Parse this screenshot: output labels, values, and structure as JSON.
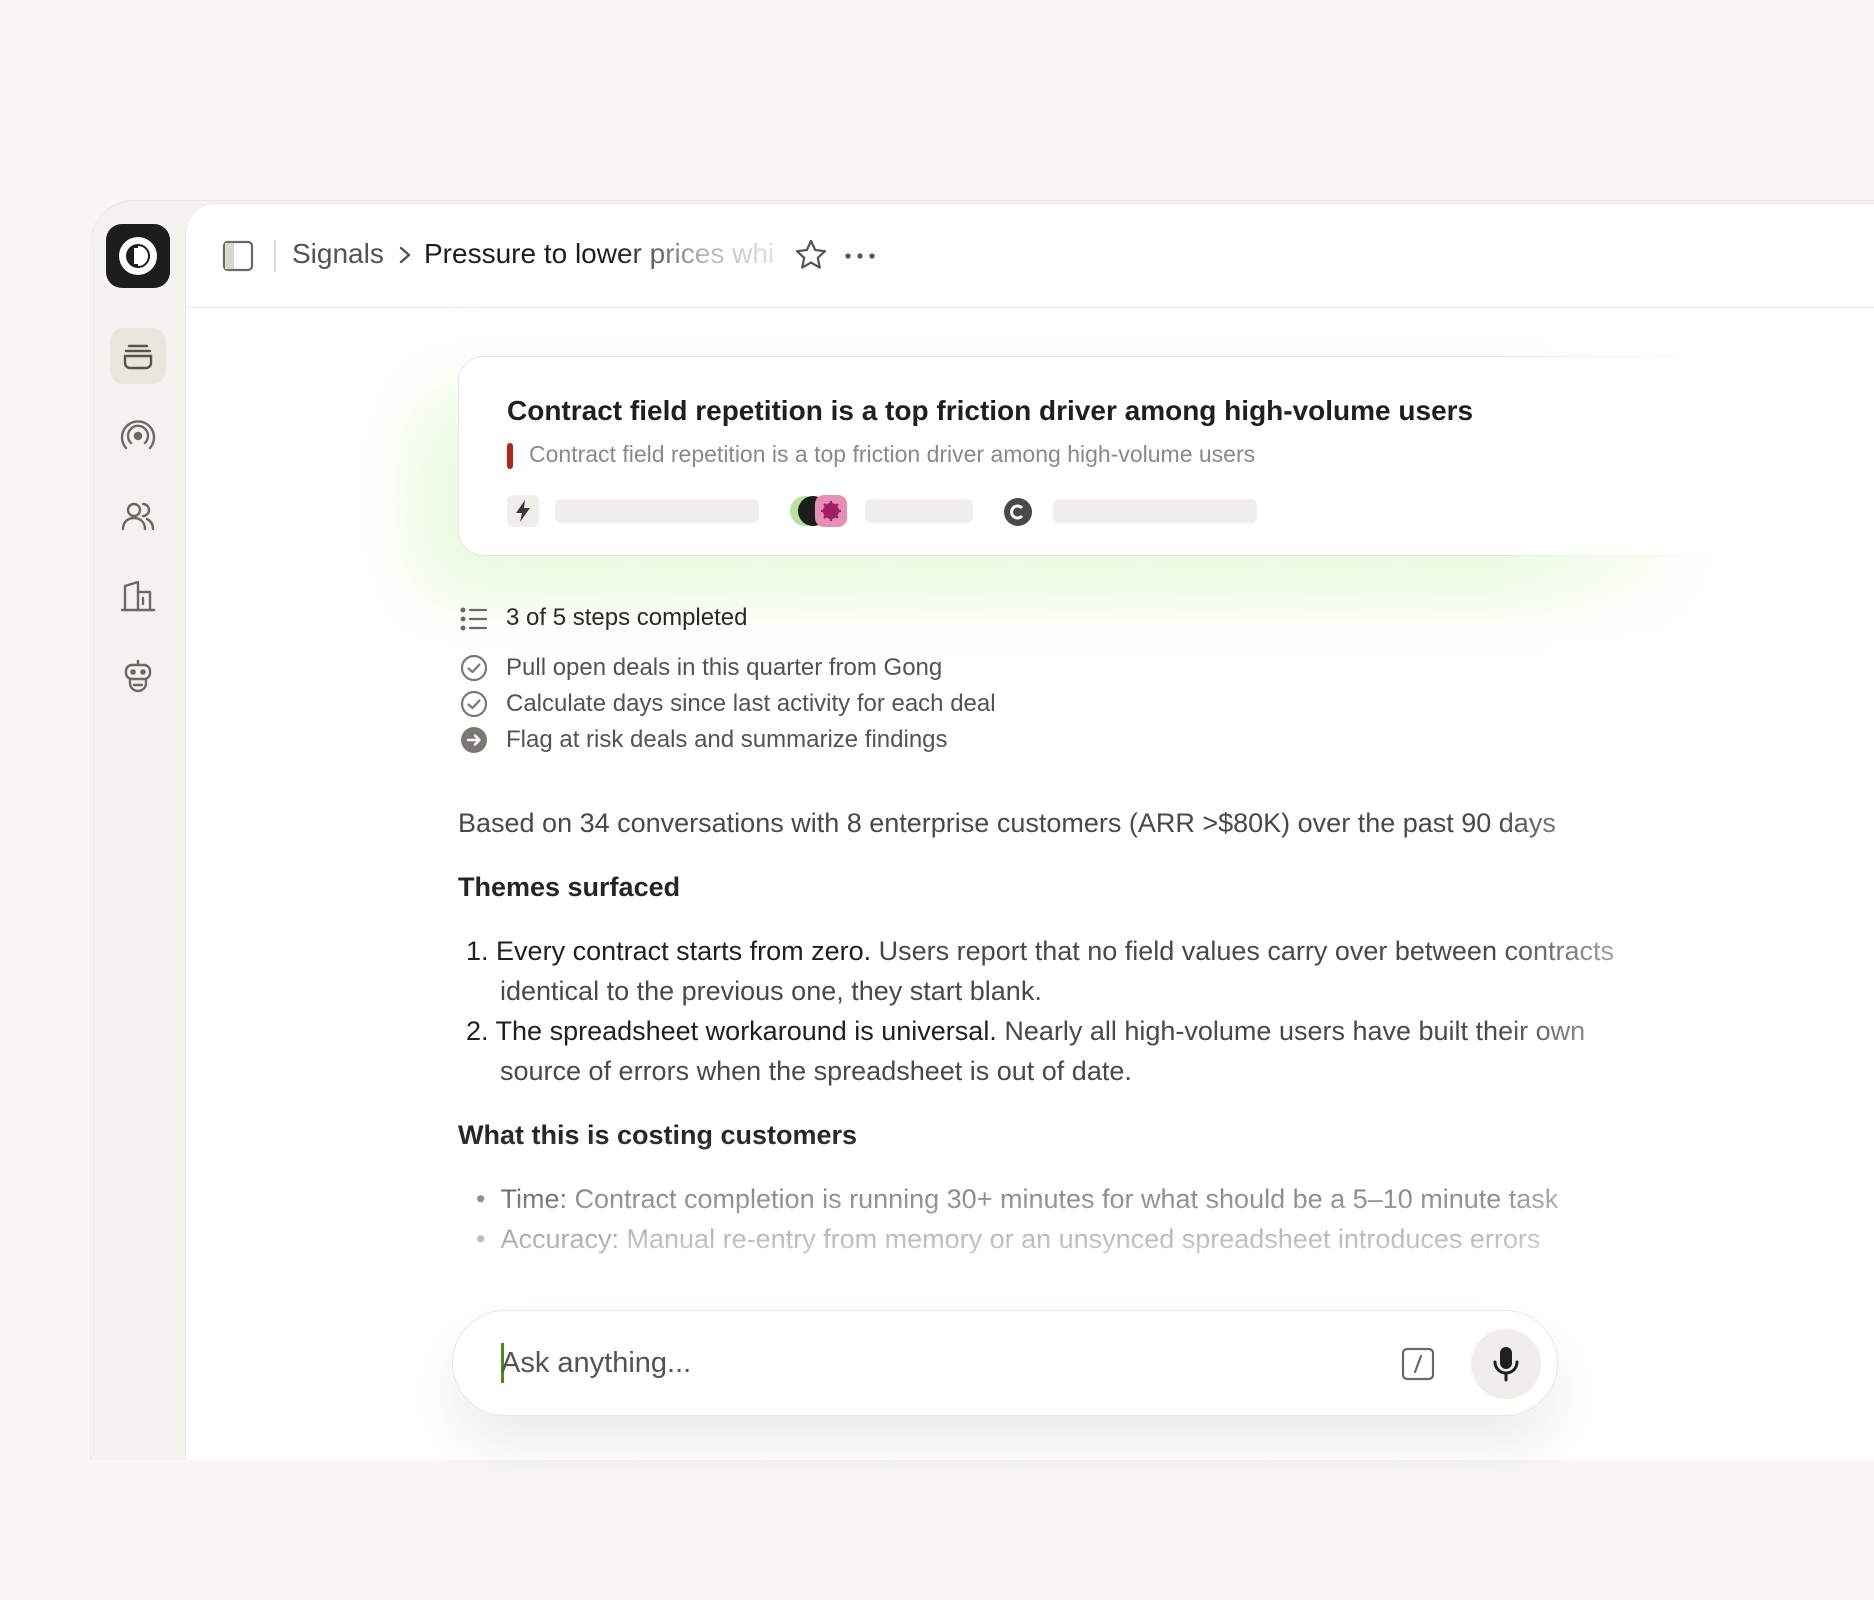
{
  "breadcrumb": {
    "root": "Signals",
    "current": "Pressure to lower prices whil"
  },
  "card": {
    "title": "Contract field repetition is a top friction driver among high-volume users",
    "subtitle": "Contract field repetition is a top friction driver among high-volume users",
    "accent_color": "#b3261e"
  },
  "steps": {
    "summary": "3 of 5 steps completed",
    "items": [
      {
        "label": "Pull open deals in this quarter from Gong",
        "status": "done"
      },
      {
        "label": "Calculate days since last activity for each deal",
        "status": "done"
      },
      {
        "label": "Flag at risk deals and summarize findings",
        "status": "in-progress"
      }
    ]
  },
  "body": {
    "intro": "Based on 34 conversations with 8 enterprise customers (ARR >$80K) over the past 90 days",
    "themes_heading": "Themes surfaced",
    "themes": [
      {
        "number": "1.",
        "lead": "Every contract starts from zero.",
        "text": " Users report that no field values carry over between contracts",
        "continuation": "identical to the previous one, they start blank."
      },
      {
        "number": "2.",
        "lead": "The spreadsheet workaround is universal.",
        "text": " Nearly all high-volume users have built their own",
        "continuation": "source of errors when the spreadsheet is out of date."
      }
    ],
    "costing_heading": "What this is costing customers",
    "costs": [
      {
        "lead": "Time:",
        "text": " Contract completion is running 30+ minutes for what should be a 5–10 minute task"
      },
      {
        "lead": "Accuracy:",
        "text": " Manual re-entry from memory or an unsynced spreadsheet introduces errors"
      }
    ]
  },
  "composer": {
    "placeholder": "Ask anything..."
  },
  "colors": {
    "background": "#f8f7f3",
    "sidebar": "#f3f2ee",
    "logo": "#1d1d1b",
    "caret": "#4a8a1e"
  }
}
